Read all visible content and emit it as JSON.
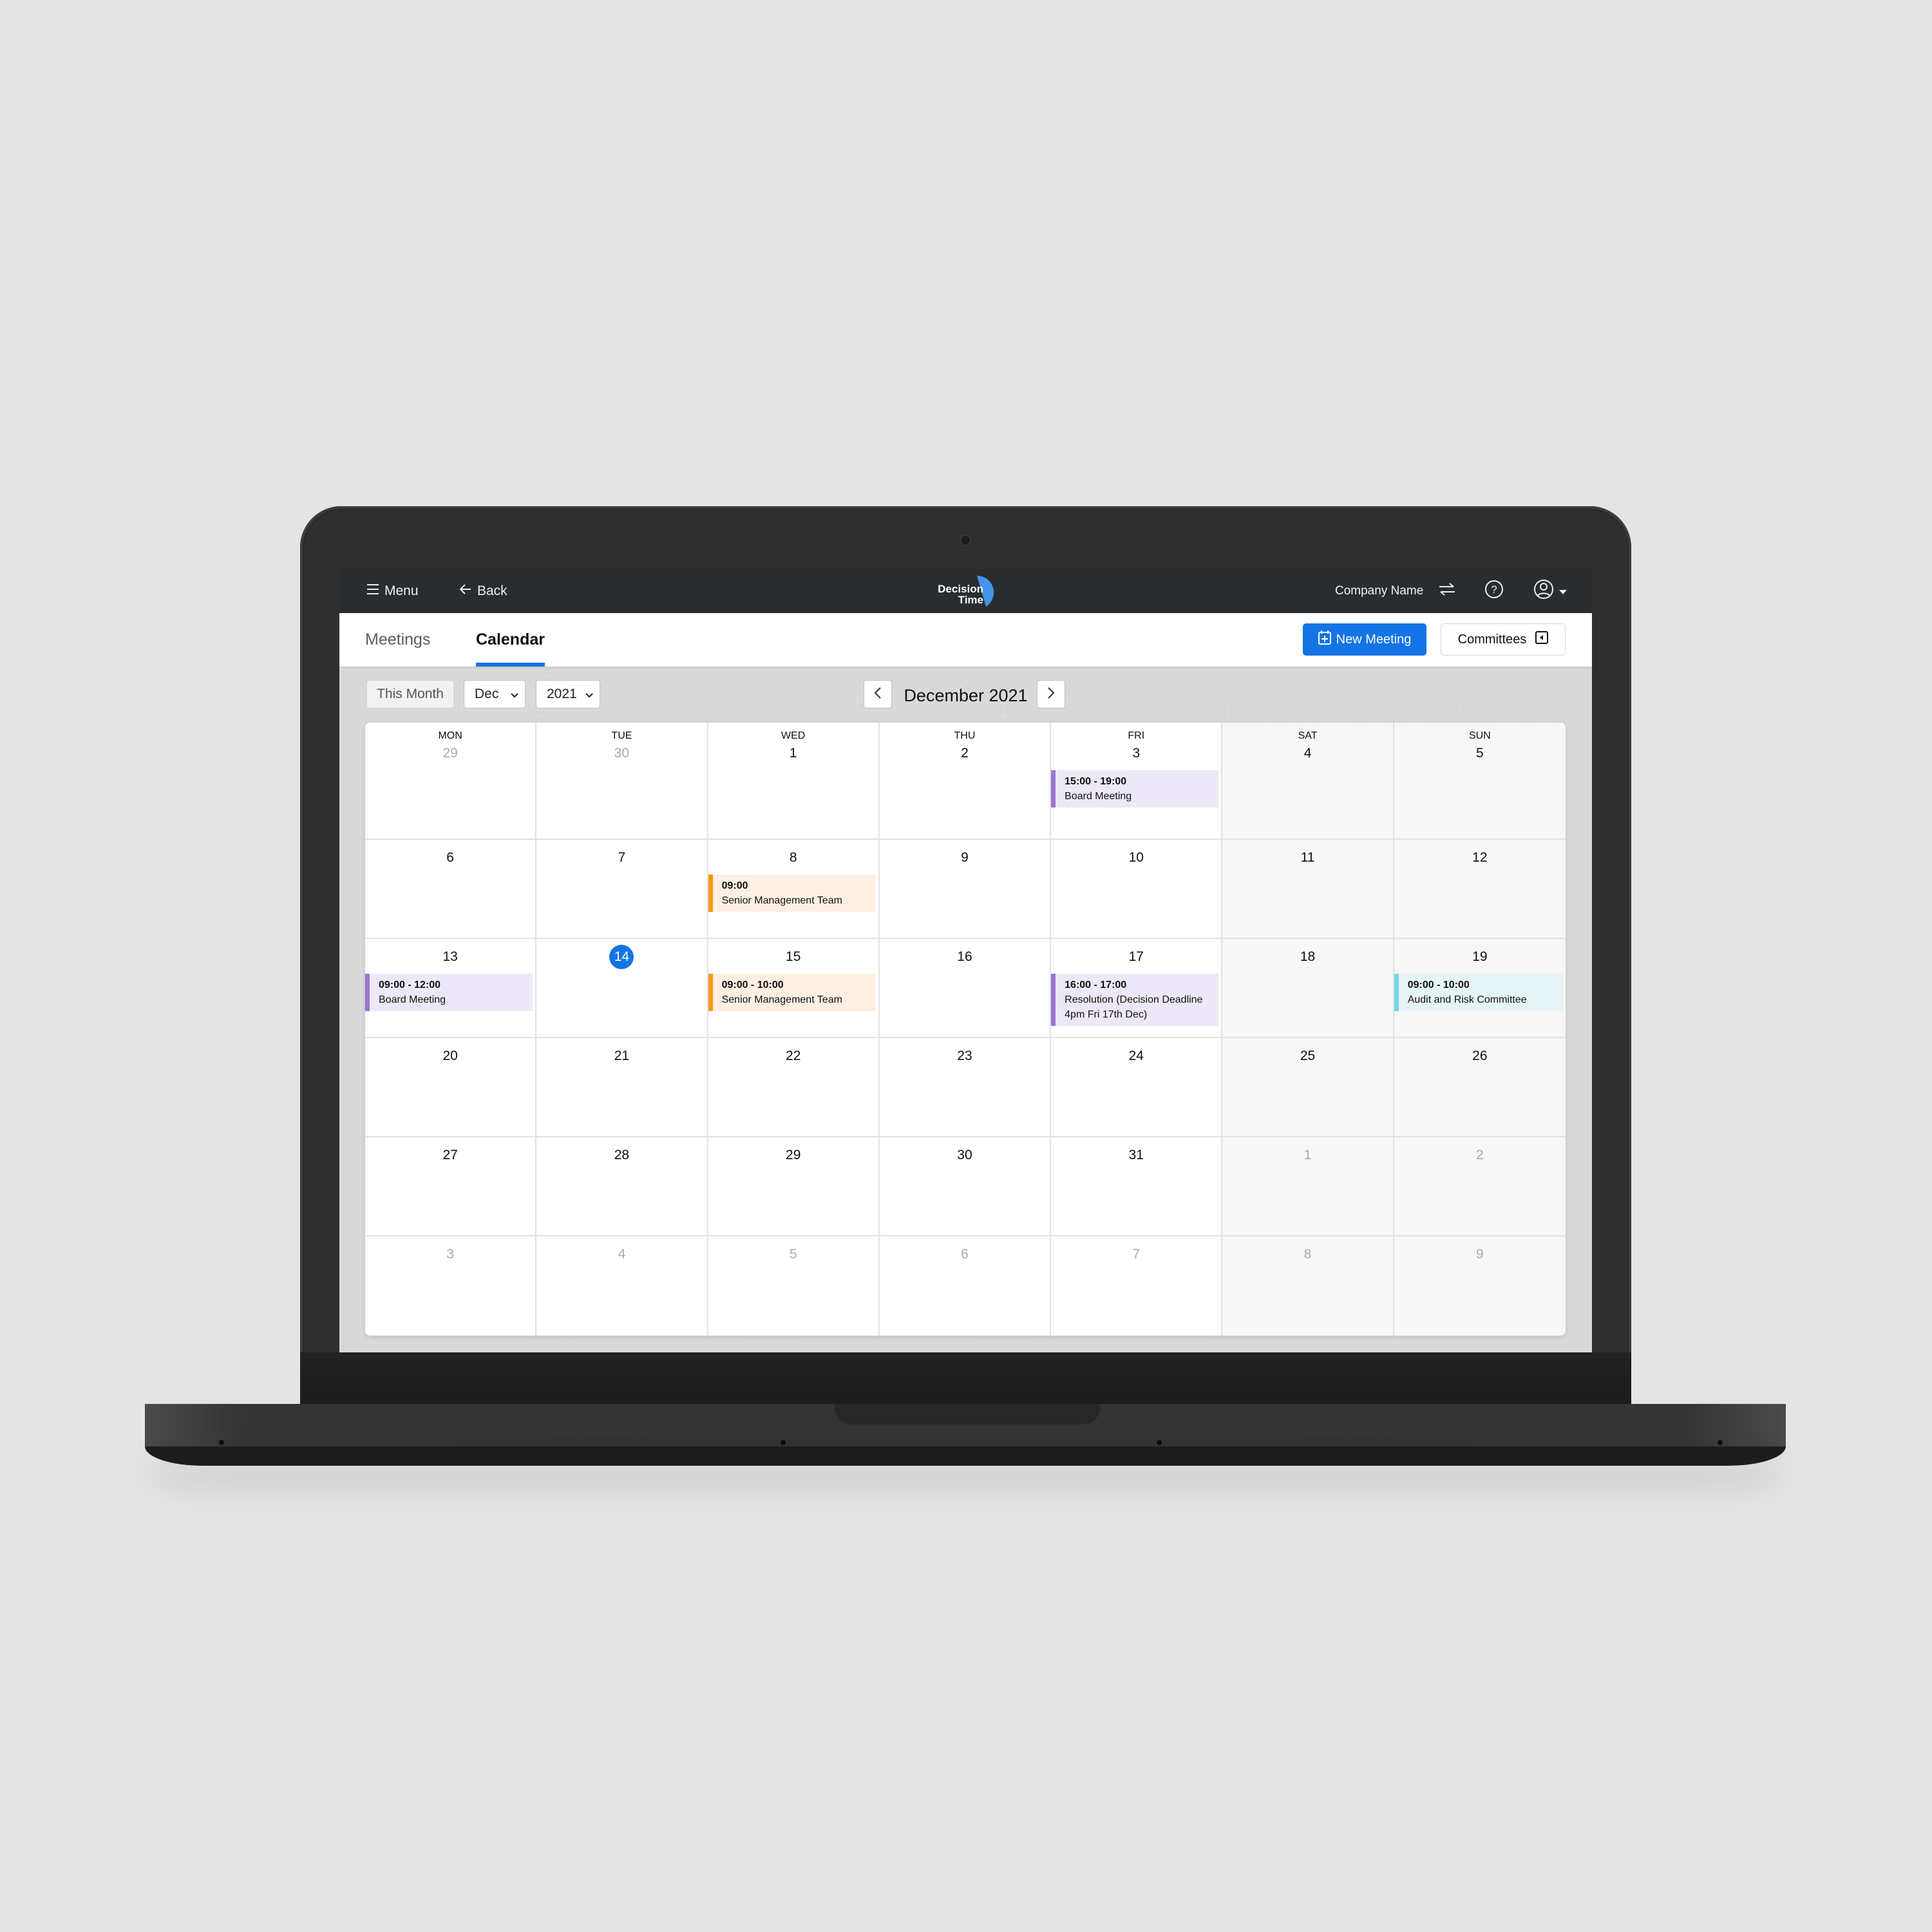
{
  "app": {
    "logo_line1": "Decision",
    "logo_line2": "Time",
    "brand_color": "#1474e5"
  },
  "topbar": {
    "menu_label": "Menu",
    "menu_icon": "hamburger-icon",
    "back_label": "Back",
    "back_icon": "arrow-left-icon",
    "company_name": "Company Name",
    "switch_icon": "swap-arrows-icon",
    "help_icon": "help-circle-icon",
    "user_icon": "user-circle-icon"
  },
  "tabs": [
    {
      "label": "Meetings",
      "active": false
    },
    {
      "label": "Calendar",
      "active": true
    }
  ],
  "actions": {
    "new_meeting_label": "New Meeting",
    "new_meeting_icon": "calendar-plus-icon",
    "committees_label": "Committees",
    "committees_icon": "collapse-panel-icon"
  },
  "controls": {
    "this_month_label": "This Month",
    "month_select_value": "Dec",
    "year_select_value": "2021",
    "month_title": "December 2021",
    "prev_icon": "chevron-left-icon",
    "next_icon": "chevron-right-icon"
  },
  "calendar": {
    "weekdays": [
      "MON",
      "TUE",
      "WED",
      "THU",
      "FRI",
      "SAT",
      "SUN"
    ],
    "today": 14,
    "weeks": [
      [
        {
          "d": "29",
          "other": true
        },
        {
          "d": "30",
          "other": true
        },
        {
          "d": "1"
        },
        {
          "d": "2"
        },
        {
          "d": "3"
        },
        {
          "d": "4"
        },
        {
          "d": "5"
        }
      ],
      [
        {
          "d": "6"
        },
        {
          "d": "7"
        },
        {
          "d": "8"
        },
        {
          "d": "9"
        },
        {
          "d": "10"
        },
        {
          "d": "11"
        },
        {
          "d": "12"
        }
      ],
      [
        {
          "d": "13"
        },
        {
          "d": "14",
          "today": true
        },
        {
          "d": "15"
        },
        {
          "d": "16"
        },
        {
          "d": "17"
        },
        {
          "d": "18"
        },
        {
          "d": "19"
        }
      ],
      [
        {
          "d": "20"
        },
        {
          "d": "21"
        },
        {
          "d": "22"
        },
        {
          "d": "23"
        },
        {
          "d": "24"
        },
        {
          "d": "25"
        },
        {
          "d": "26"
        }
      ],
      [
        {
          "d": "27"
        },
        {
          "d": "28"
        },
        {
          "d": "29"
        },
        {
          "d": "30"
        },
        {
          "d": "31"
        },
        {
          "d": "1",
          "other": true
        },
        {
          "d": "2",
          "other": true
        }
      ],
      [
        {
          "d": "3",
          "other": true
        },
        {
          "d": "4",
          "other": true
        },
        {
          "d": "5",
          "other": true
        },
        {
          "d": "6",
          "other": true
        },
        {
          "d": "7",
          "other": true
        },
        {
          "d": "8",
          "other": true
        },
        {
          "d": "9",
          "other": true
        }
      ]
    ],
    "events": [
      {
        "week": 0,
        "day": 4,
        "time": "15:00 - 19:00",
        "title": "Board Meeting",
        "color": "purple"
      },
      {
        "week": 1,
        "day": 2,
        "time": "09:00",
        "title": "Senior Management Team",
        "color": "orange"
      },
      {
        "week": 2,
        "day": 0,
        "time": "09:00 - 12:00",
        "title": "Board Meeting",
        "color": "purple"
      },
      {
        "week": 2,
        "day": 2,
        "time": "09:00 - 10:00",
        "title": "Senior Management Team",
        "color": "orange"
      },
      {
        "week": 2,
        "day": 4,
        "time": "16:00 - 17:00",
        "title": "Resolution (Decision Deadline 4pm Fri 17th Dec)",
        "color": "purple"
      },
      {
        "week": 2,
        "day": 6,
        "time": "09:00 - 10:00",
        "title": "Audit and Risk Committee",
        "color": "teal"
      }
    ],
    "event_colors": {
      "purple": "#9a76d0",
      "orange": "#f59a17",
      "teal": "#72d7e3"
    }
  }
}
